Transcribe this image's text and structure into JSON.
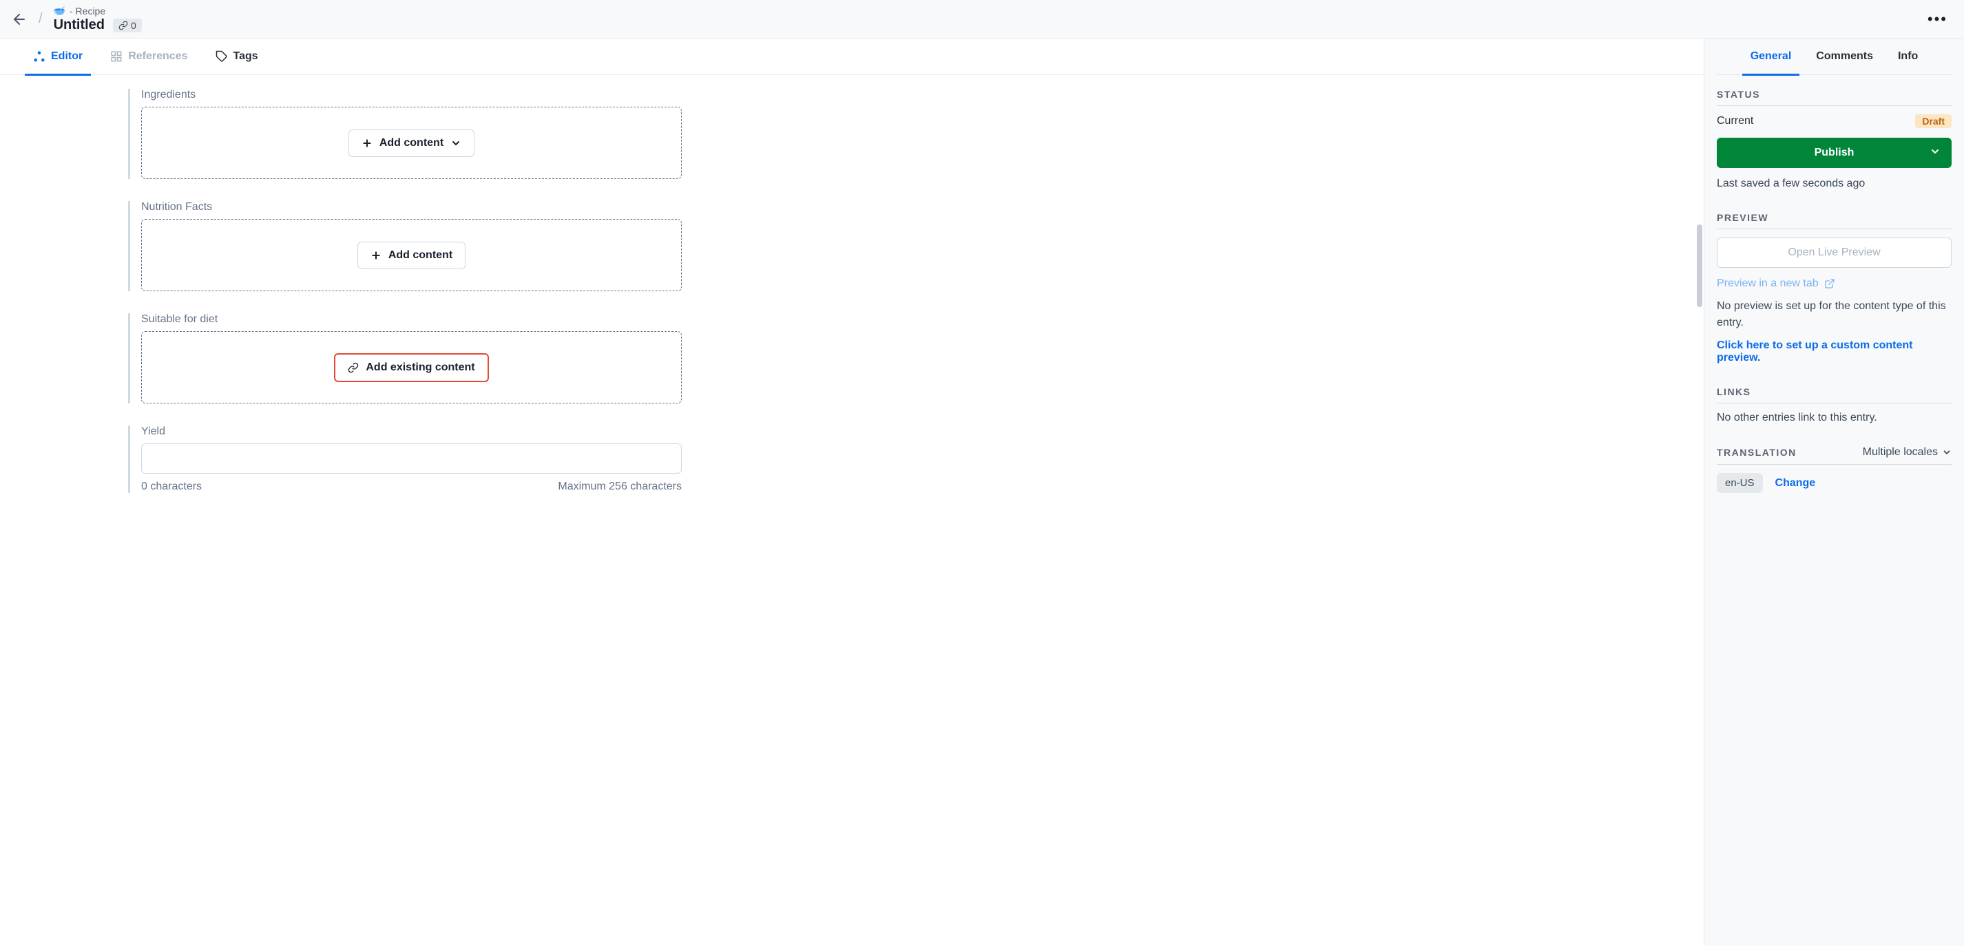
{
  "header": {
    "breadcrumb_type": "- Recipe",
    "title": "Untitled",
    "link_count": "0"
  },
  "main_tabs": {
    "editor": "Editor",
    "references": "References",
    "tags": "Tags"
  },
  "fields": {
    "ingredients": {
      "label": "Ingredients",
      "button": "Add content"
    },
    "nutrition": {
      "label": "Nutrition Facts",
      "button": "Add content"
    },
    "diet": {
      "label": "Suitable for diet",
      "button": "Add existing content"
    },
    "yield": {
      "label": "Yield",
      "char_count": "0 characters",
      "max": "Maximum 256 characters"
    }
  },
  "sidebar": {
    "tabs": {
      "general": "General",
      "comments": "Comments",
      "info": "Info"
    },
    "status": {
      "heading": "STATUS",
      "current_label": "Current",
      "draft_badge": "Draft",
      "publish_label": "Publish",
      "last_saved": "Last saved a few seconds ago"
    },
    "preview": {
      "heading": "PREVIEW",
      "open_button": "Open Live Preview",
      "new_tab_link": "Preview in a new tab",
      "note": "No preview is set up for the content type of this entry.",
      "setup_link": "Click here to set up a custom content preview."
    },
    "links": {
      "heading": "LINKS",
      "text": "No other entries link to this entry."
    },
    "translation": {
      "heading": "TRANSLATION",
      "mode": "Multiple locales",
      "locale": "en-US",
      "change": "Change"
    }
  }
}
